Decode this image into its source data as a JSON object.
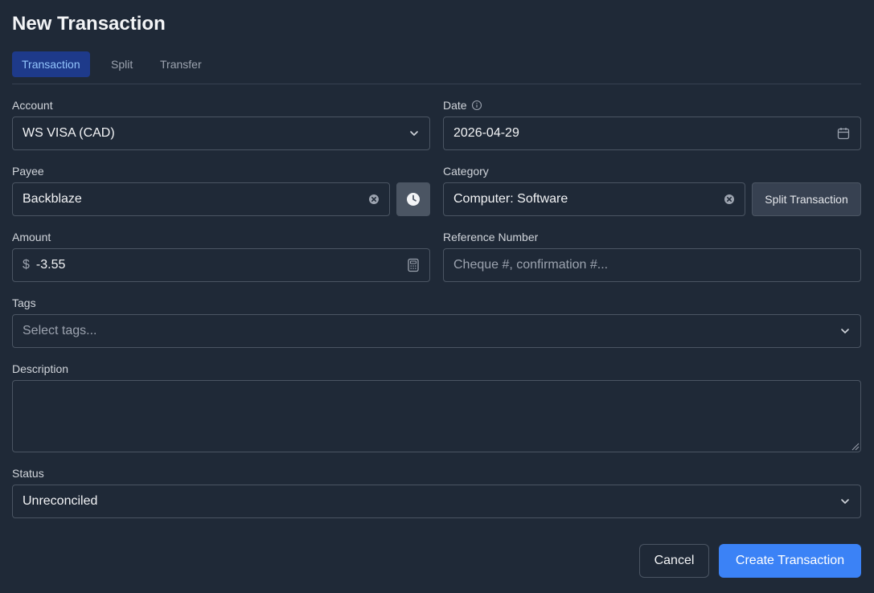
{
  "page": {
    "title": "New Transaction"
  },
  "tabs": [
    {
      "label": "Transaction",
      "active": true
    },
    {
      "label": "Split",
      "active": false
    },
    {
      "label": "Transfer",
      "active": false
    }
  ],
  "account": {
    "label": "Account",
    "value": "WS VISA (CAD)",
    "icon": "chevron-down-icon"
  },
  "date": {
    "label": "Date",
    "value": "2026-04-29",
    "info_icon": "info-icon",
    "icon": "calendar-icon"
  },
  "payee": {
    "label": "Payee",
    "value": "Backblaze",
    "clear_icon": "clear-icon",
    "history_icon": "clock-icon"
  },
  "category": {
    "label": "Category",
    "value": "Computer: Software",
    "clear_icon": "clear-icon",
    "split_button": "Split Transaction"
  },
  "amount": {
    "label": "Amount",
    "currency_symbol": "$",
    "value": "-3.55",
    "icon": "calculator-icon"
  },
  "reference": {
    "label": "Reference Number",
    "placeholder": "Cheque #, confirmation #..."
  },
  "tags": {
    "label": "Tags",
    "placeholder": "Select tags...",
    "icon": "chevron-down-icon"
  },
  "description": {
    "label": "Description",
    "value": ""
  },
  "status": {
    "label": "Status",
    "value": "Unreconciled",
    "icon": "chevron-down-icon"
  },
  "actions": {
    "cancel": "Cancel",
    "create": "Create Transaction"
  },
  "colors": {
    "background": "#1f2937",
    "accent": "#3b82f6",
    "tab_active_bg": "#1e3a8a",
    "border": "#4b5563"
  }
}
